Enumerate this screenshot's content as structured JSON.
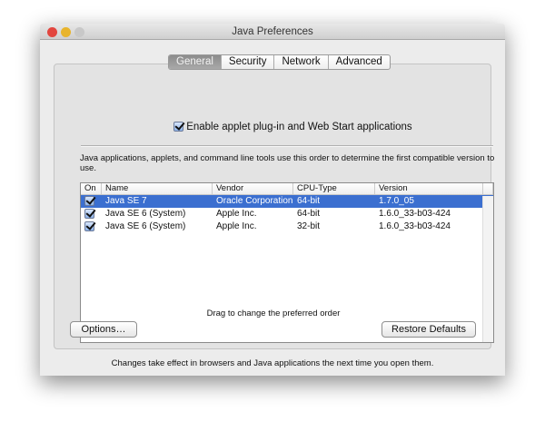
{
  "window": {
    "title": "Java Preferences"
  },
  "tabs": [
    {
      "label": "General",
      "selected": true
    },
    {
      "label": "Security"
    },
    {
      "label": "Network"
    },
    {
      "label": "Advanced"
    }
  ],
  "general": {
    "enable_applet": {
      "label": "Enable applet plug-in and Web Start applications",
      "checked": true
    },
    "description": "Java applications, applets, and command line tools use this order to determine the first compatible version to use.",
    "table": {
      "columns": [
        "On",
        "Name",
        "Vendor",
        "CPU-Type",
        "Version"
      ],
      "rows": [
        {
          "on": true,
          "name": "Java SE 7",
          "vendor": "Oracle Corporation",
          "cpu": "64-bit",
          "version": "1.7.0_05",
          "selected": true
        },
        {
          "on": true,
          "name": "Java SE 6 (System)",
          "vendor": "Apple Inc.",
          "cpu": "64-bit",
          "version": "1.6.0_33-b03-424"
        },
        {
          "on": true,
          "name": "Java SE 6 (System)",
          "vendor": "Apple Inc.",
          "cpu": "32-bit",
          "version": "1.6.0_33-b03-424"
        }
      ]
    },
    "hint": "Drag to change the preferred order",
    "options_button": "Options…",
    "restore_button": "Restore Defaults"
  },
  "footer": "Changes take effect in browsers and Java applications the next time you open them.",
  "colors": {
    "selection": "#3b6fd0",
    "close": "#e2463f",
    "minimize": "#e8b42c",
    "zoom": "#c8c8c8"
  }
}
